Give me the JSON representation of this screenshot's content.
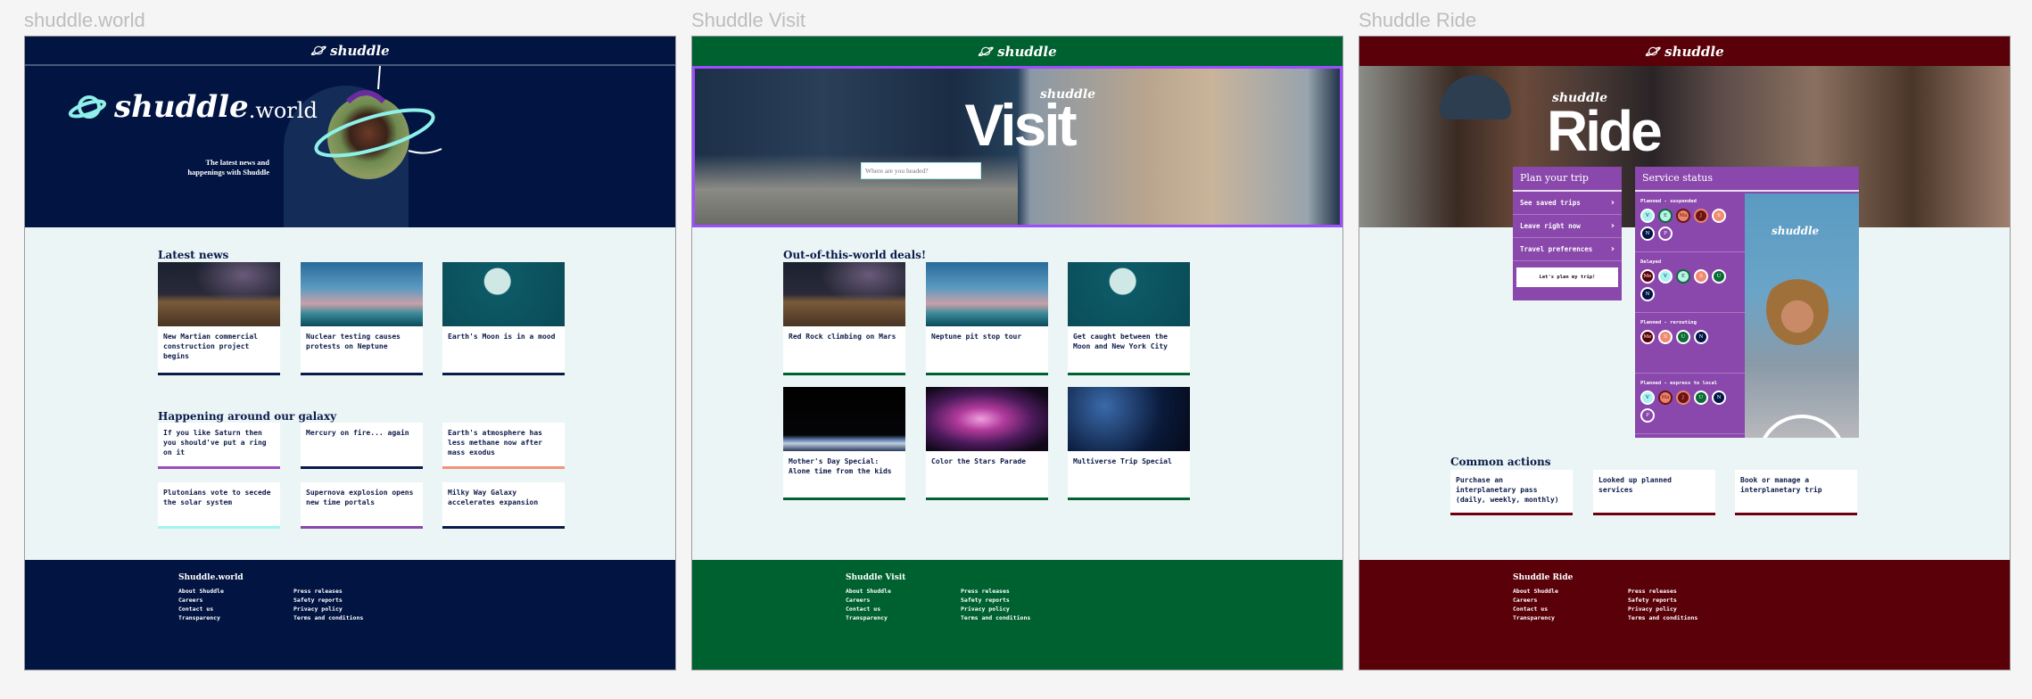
{
  "colors": {
    "world": "#011442",
    "visit": "#006130",
    "ride": "#5a0009",
    "purple": "#8a47ac",
    "accent": "#9b4dff",
    "cyan": "#8ff0ea"
  },
  "brand": "shuddle",
  "world": {
    "label": "shuddle.world",
    "hero": {
      "brand": "shuddle",
      "suffix": ".world",
      "tagline": [
        "The latest news and",
        "happenings with Shuddle"
      ]
    },
    "latest_heading": "Latest news",
    "latest": [
      {
        "title": "New Martian commercial construction project begins",
        "image": "canyon-night"
      },
      {
        "title": "Nuclear testing causes protests on Neptune",
        "image": "rocket-launch"
      },
      {
        "title": "Earth's Moon is in a mood",
        "image": "moon"
      }
    ],
    "galaxy_heading": "Happening around our galaxy",
    "galaxy": [
      {
        "title": "If you like Saturn then you should've put a ring on it",
        "accent": "#9b4dbf"
      },
      {
        "title": "Mercury on fire... again",
        "accent": "#0a1a4a"
      },
      {
        "title": "Earth's atmosphere has less methane now after mass exodus",
        "accent": "#f2937a"
      },
      {
        "title": "Plutonians vote to secede the solar system",
        "accent": "#9ff5ef"
      },
      {
        "title": "Supernova explosion opens new time portals",
        "accent": "#8a47ac"
      },
      {
        "title": "Milky Way Galaxy accelerates expansion",
        "accent": "#0a1a4a"
      }
    ],
    "footer": {
      "title": "Shuddle.world"
    }
  },
  "visit": {
    "label": "Shuddle Visit",
    "hero": {
      "brand": "shuddle",
      "word": "Visit",
      "search_placeholder": "Where are you headed?"
    },
    "deals_heading": "Out-of-this-world deals!",
    "deals": [
      {
        "title": "Red Rock climbing on Mars",
        "image": "canyon-night"
      },
      {
        "title": "Neptune pit stop tour",
        "image": "rocket-launch"
      },
      {
        "title": "Get caught between the Moon and New York City",
        "image": "moon"
      },
      {
        "title": "Mother's Day Special: Alone time from the kids",
        "image": "astronaut"
      },
      {
        "title": "Color the Stars Parade",
        "image": "nebula"
      },
      {
        "title": "Multiverse Trip Special",
        "image": "star-rain"
      }
    ],
    "footer": {
      "title": "Shuddle Visit"
    }
  },
  "ride": {
    "label": "Shuddle Ride",
    "hero": {
      "brand": "shuddle",
      "word": "Ride"
    },
    "plan": {
      "title": "Plan your trip",
      "items": [
        "See saved trips",
        "Leave right now",
        "Travel preferences"
      ],
      "button": "Let's plan my trip!"
    },
    "status": {
      "title": "Service status",
      "groups": [
        {
          "label": "Planned - suspended",
          "lines": [
            "V",
            "E",
            "Ma",
            "J",
            "S",
            "N",
            "P"
          ]
        },
        {
          "label": "Delayed",
          "lines": [
            "Me",
            "V",
            "E",
            "S",
            "U",
            "N"
          ]
        },
        {
          "label": "Planned - rerouting",
          "lines": [
            "Me",
            "S",
            "U",
            "N"
          ]
        },
        {
          "label": "Planned - express to local",
          "lines": [
            "V",
            "Ma",
            "J",
            "U",
            "N",
            "P"
          ]
        }
      ],
      "promo_brand": "shuddle"
    },
    "actions_heading": "Common actions",
    "actions": [
      "Purchase an interplanetary pass (daily, weekly, monthly)",
      "Looked up planned services",
      "Book or manage a interplanetary trip"
    ],
    "footer": {
      "title": "Shuddle Ride"
    }
  },
  "footer_links": {
    "col1": [
      "About Shuddle",
      "Careers",
      "Contact us",
      "Transparency"
    ],
    "col2": [
      "Press releases",
      "Safety reports",
      "Privacy policy",
      "Terms and conditions"
    ]
  },
  "line_styles": {
    "V": {
      "bg": "#a8f3f0",
      "fg": "#0a1a4a",
      "ring": "#ffffff"
    },
    "E": {
      "bg": "#b8f5e2",
      "fg": "#0a4a2a",
      "ring": "#0a6b3b"
    },
    "Ma": {
      "bg": "#e8846c",
      "fg": "#6b1212",
      "ring": "#6b1212"
    },
    "J": {
      "bg": "#6b1212",
      "fg": "#f2a080",
      "ring": "#e8846c"
    },
    "S": {
      "bg": "#f08a70",
      "fg": "#ffffff",
      "ring": "#ffffff"
    },
    "N": {
      "bg": "#021545",
      "fg": "#ffffff",
      "ring": "#ffffff"
    },
    "P": {
      "bg": "#8a47ac",
      "fg": "#ffffff",
      "ring": "#ffffff"
    },
    "Me": {
      "bg": "#5a0008",
      "fg": "#ffffff",
      "ring": "#ffffff"
    },
    "U": {
      "bg": "#0a6b35",
      "fg": "#ffffff",
      "ring": "#ffffff"
    }
  }
}
